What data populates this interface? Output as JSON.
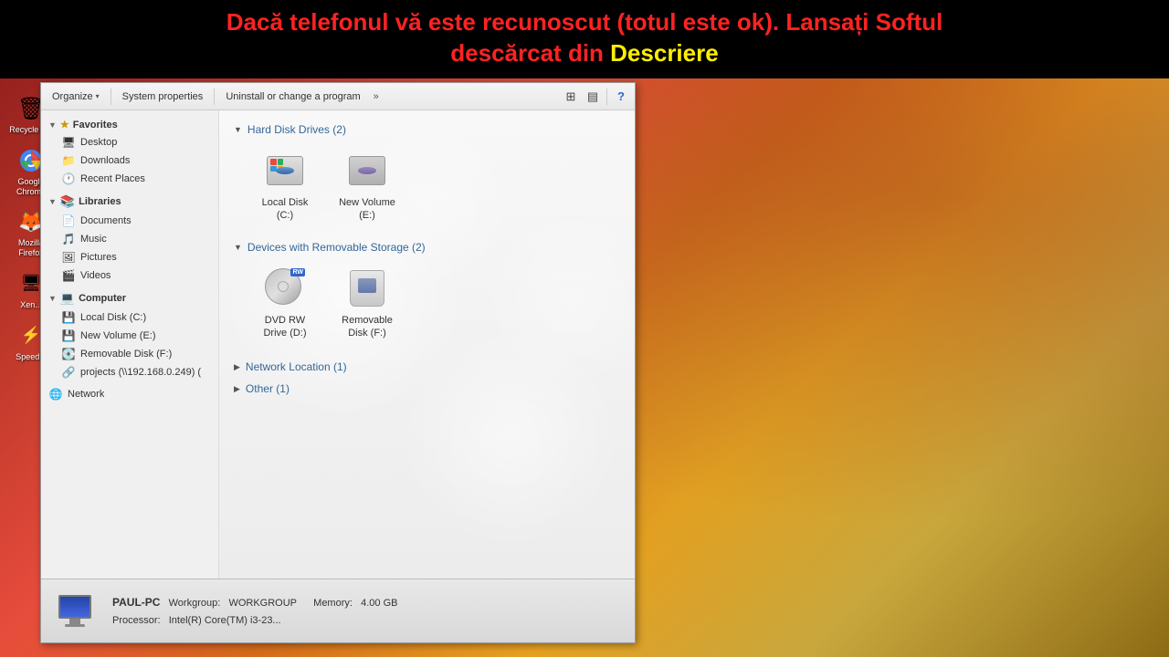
{
  "banner": {
    "line1": "Dacă  telefonul vă este recunoscut (totul este ok). Lansați Softul",
    "line2_prefix": "descărcat din ",
    "line2_highlight": "Descriere"
  },
  "toolbar": {
    "organize_label": "Organize",
    "system_properties_label": "System properties",
    "uninstall_label": "Uninstall or change a program",
    "more_label": "»"
  },
  "sidebar": {
    "favorites_label": "Favorites",
    "desktop_label": "Desktop",
    "downloads_label": "Downloads",
    "recent_places_label": "Recent Places",
    "libraries_label": "Libraries",
    "documents_label": "Documents",
    "music_label": "Music",
    "pictures_label": "Pictures",
    "videos_label": "Videos",
    "computer_label": "Computer",
    "local_disk_c_label": "Local Disk (C:)",
    "new_volume_e_label": "New Volume (E:)",
    "removable_disk_f_label": "Removable Disk (F:)",
    "projects_label": "projects (\\\\192.168.0.249) (",
    "network_label": "Network"
  },
  "content": {
    "hard_disk_drives_label": "Hard Disk Drives (2)",
    "local_disk_c_label": "Local Disk",
    "local_disk_c_sub": "(C:)",
    "new_volume_e_label": "New Volume (E:)",
    "devices_removable_label": "Devices with Removable Storage (2)",
    "dvd_rw_label": "DVD RW Drive (D:)",
    "removable_disk_f_label": "Removable Disk (F:)",
    "dvd_rw_badge": "RW",
    "network_location_label": "Network Location (1)",
    "other_label": "Other (1)"
  },
  "status_bar": {
    "computer_name": "PAUL-PC",
    "workgroup_label": "Workgroup:",
    "workgroup_value": "WORKGROUP",
    "memory_label": "Memory:",
    "memory_value": "4.00 GB",
    "processor_label": "Processor:",
    "processor_value": "Intel(R) Core(TM) i3-23..."
  },
  "desktop_icons": [
    {
      "label": "Recycle\nBin",
      "icon": "🗑"
    },
    {
      "label": "Google\nChrome",
      "icon": "⬤"
    },
    {
      "label": "Mozilla\nFirefox",
      "icon": "🦊"
    },
    {
      "label": "Xen...",
      "icon": "🖥"
    },
    {
      "label": "Speed...",
      "icon": "⚡"
    }
  ]
}
